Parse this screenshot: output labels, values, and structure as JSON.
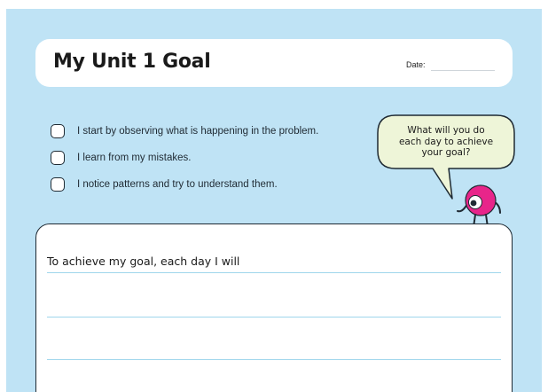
{
  "header": {
    "title": "My Unit 1 Goal",
    "date_label": "Date:"
  },
  "checklist": {
    "items": [
      {
        "label": "I start by observing what is happening in the problem.",
        "checked": false
      },
      {
        "label": "I learn from my mistakes.",
        "checked": false
      },
      {
        "label": "I notice patterns and try to understand them.",
        "checked": false
      }
    ]
  },
  "speech_bubble": {
    "lines": [
      "What will you do",
      "each day to achieve",
      "your goal?"
    ]
  },
  "writing_area": {
    "prompt": "To achieve my goal, each day I will",
    "line_count": 3
  },
  "colors": {
    "background": "#bfe3f5",
    "card": "#ffffff",
    "bubble_fill": "#eef5d8",
    "character": "#e8258a",
    "rule_line": "#9fd6ec"
  },
  "icons": [
    "checkbox-icon",
    "speech-bubble-icon",
    "mascot-character-icon"
  ]
}
